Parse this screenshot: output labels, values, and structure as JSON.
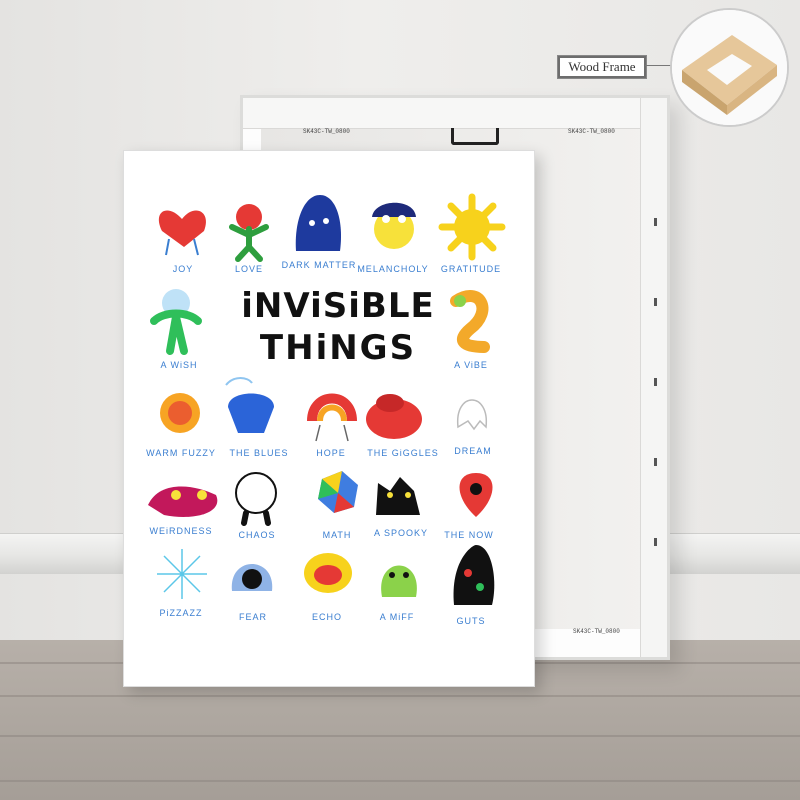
{
  "callout": {
    "label": "Wood Frame"
  },
  "poster": {
    "title_line1": "iNViSiBLE",
    "title_line2": "THiNGS",
    "labels": {
      "joy": "JOY",
      "love": "LOVE",
      "dark_matter": "DARK MATTER",
      "melancholy": "MELANCHOLY",
      "gratitude": "GRATITUDE",
      "a_wish": "A WiSH",
      "a_vibe": "A ViBE",
      "warm_fuzzy": "WARM FUZZY",
      "the_blues": "THE BLUES",
      "hope": "HOPE",
      "the_giggles": "THE GiGGLES",
      "dream": "DREAM",
      "weirdness": "WEiRDNESS",
      "chaos": "CHAOS",
      "math": "MATH",
      "a_spooky": "A SPOOKY",
      "the_now": "THE NOW",
      "pizzazz": "PiZZAZZ",
      "fear": "FEAR",
      "echo": "ECHO",
      "a_miff": "A MiFF",
      "guts": "GUTS"
    }
  },
  "canvas_back": {
    "sku_top_left": "SK43C-TW_0800",
    "sku_top_right": "SK43C-TW_0800",
    "sku_bottom": "SK43C-TW_0800"
  },
  "colors": {
    "label_blue": "#3a7ed0",
    "poster_bg": "#ffffff",
    "wall": "#ecebe9",
    "floor": "#ada69f"
  }
}
